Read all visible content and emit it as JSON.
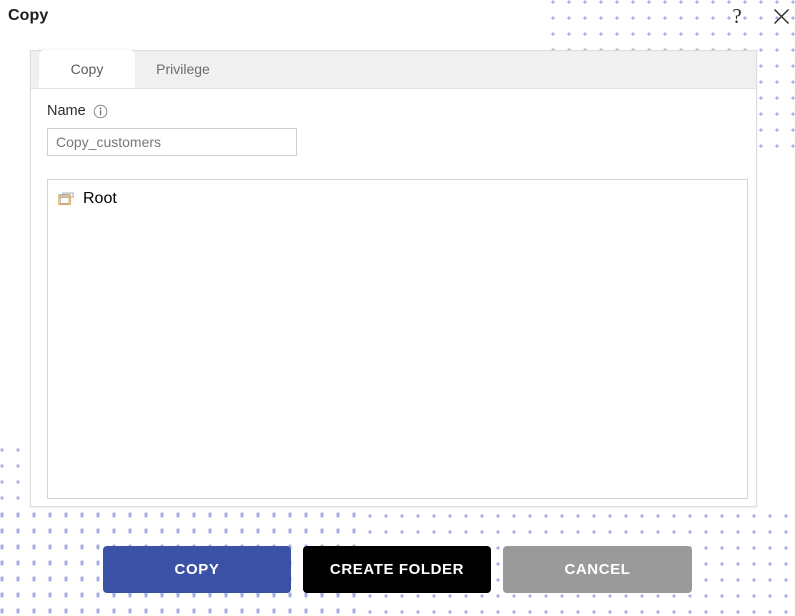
{
  "window": {
    "title": "Copy",
    "help_icon": "question-mark-icon",
    "close_icon": "close-icon"
  },
  "tabs": [
    {
      "label": "Copy",
      "active": true
    },
    {
      "label": "Privilege",
      "active": false
    }
  ],
  "form": {
    "name_label": "Name",
    "info_icon": "info-icon",
    "name_value": "Copy_customers",
    "name_placeholder": "Copy_customers"
  },
  "tree": {
    "items": [
      {
        "label": "Root",
        "icon": "folder-icon",
        "depth": 0
      }
    ]
  },
  "footer": {
    "copy_label": "COPY",
    "create_folder_label": "CREATE FOLDER",
    "cancel_label": "CANCEL"
  },
  "colors": {
    "primary": "#3a51a5",
    "secondary": "#000000",
    "muted": "#9a9a9a",
    "dot_pattern": "#8e9ad6",
    "tab_inactive_bg": "#f0f0f0",
    "panel_border": "#dcdcdc"
  }
}
